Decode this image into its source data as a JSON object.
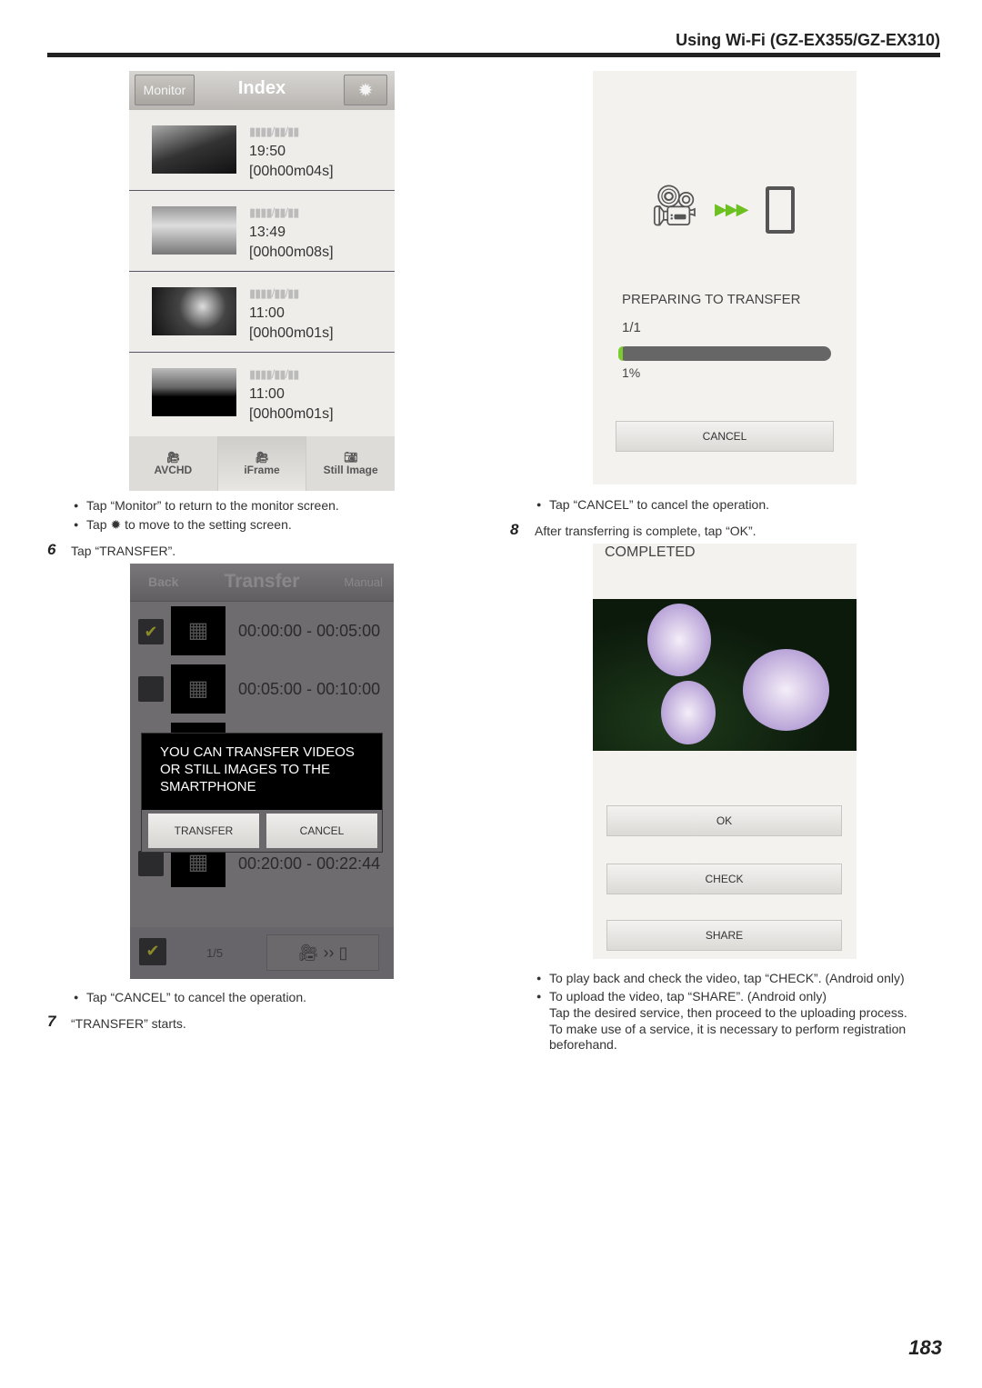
{
  "header": {
    "title": "Using Wi-Fi (GZ-EX355/GZ-EX310)"
  },
  "index_screen": {
    "monitor_button": "Monitor",
    "title": "Index",
    "settings_icon": "gear-icon",
    "items": [
      {
        "date": "▮▮▮▮/▮▮/▮▮",
        "time": "19:50",
        "duration": "[00h00m04s]"
      },
      {
        "date": "▮▮▮▮/▮▮/▮▮",
        "time": "13:49",
        "duration": "[00h00m08s]"
      },
      {
        "date": "▮▮▮▮/▮▮/▮▮",
        "time": "11:00",
        "duration": "[00h00m01s]"
      },
      {
        "date": "▮▮▮▮/▮▮/▮▮",
        "time": "11:00",
        "duration": "[00h00m01s]"
      }
    ],
    "tabs": [
      {
        "label": "AVCHD",
        "icon": "video-camera-icon"
      },
      {
        "label": "iFrame",
        "icon": "video-camera-icon",
        "selected": true
      },
      {
        "label": "Still Image",
        "icon": "camera-icon"
      }
    ]
  },
  "left_notes": {
    "n1": "Tap “Monitor” to return to the monitor screen.",
    "n2a": "Tap",
    "n2b": "to move to the setting screen.",
    "step6_num": "6",
    "step6": "Tap “TRANSFER”.",
    "n3": "Tap “CANCEL” to cancel the operation.",
    "step7_num": "7",
    "step7": "“TRANSFER” starts."
  },
  "transfer_screen": {
    "back": "Back",
    "title": "Transfer",
    "manual": "Manual",
    "rows": [
      {
        "range": "00:00:00 - 00:05:00",
        "checked": true
      },
      {
        "range": "00:05:00 - 00:10:00",
        "checked": false
      },
      {
        "range": "00:20:00 - 00:22:44",
        "checked": false
      }
    ],
    "dialog": {
      "line1": "YOU CAN TRANSFER VIDEOS",
      "line2": "OR STILL IMAGES TO THE",
      "line3": "SMARTPHONE",
      "transfer": "TRANSFER",
      "cancel": "CANCEL"
    },
    "counter": "1/5"
  },
  "progress_screen": {
    "status": "PREPARING TO TRANSFER",
    "count": "1/1",
    "percent_label": "1%",
    "progress": 1,
    "cancel": "CANCEL"
  },
  "right_notes": {
    "n1": "Tap “CANCEL” to cancel the operation.",
    "step8_num": "8",
    "step8": "After transferring is complete, tap “OK”.",
    "n2": "To play back and check the video, tap “CHECK”. (Android only)",
    "n3": "To upload the video, tap “SHARE”. (Android only)",
    "n3b": "Tap the desired service, then proceed to the uploading process.",
    "n3c": "To make use of a service, it is necessary to perform registration",
    "n3d": "beforehand."
  },
  "completed_screen": {
    "status": "COMPLETED",
    "ok": "OK",
    "check": "CHECK",
    "share": "SHARE"
  },
  "page_number": "183"
}
